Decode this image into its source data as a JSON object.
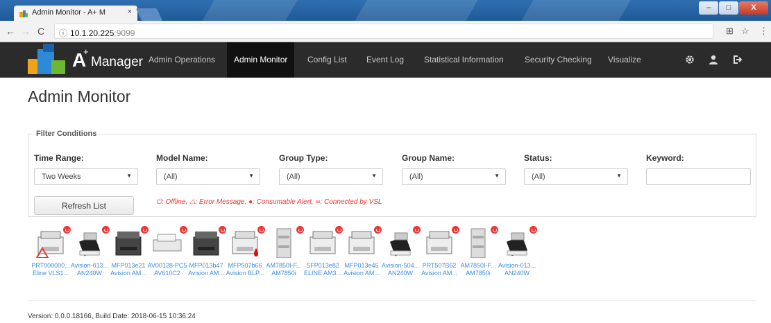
{
  "browser": {
    "tab_title": "Admin Monitor - A+ M",
    "tab_close": "×",
    "url_host": "10.1.20.225",
    "url_port": ":9099",
    "window_buttons": [
      "–",
      "□",
      "X"
    ]
  },
  "app": {
    "logo_letter": "A",
    "logo_plus": "+",
    "logo_text": "Manager",
    "nav": [
      {
        "label": "Admin Operations"
      },
      {
        "label": "Admin Monitor",
        "active": true
      },
      {
        "label": "Config List"
      },
      {
        "label": "Event Log"
      },
      {
        "label": "Statistical Information"
      },
      {
        "label": "Security Checking"
      },
      {
        "label": "Visualize"
      }
    ],
    "nav_icons": [
      "gear-icon",
      "user-icon",
      "logout-icon"
    ]
  },
  "page": {
    "title": "Admin Monitor",
    "filter_legend": "Filter Conditions",
    "filters": {
      "time_range": {
        "label": "Time Range:",
        "value": "Two Weeks"
      },
      "model_name": {
        "label": "Model Name:",
        "value": "(All)"
      },
      "group_type": {
        "label": "Group Type:",
        "value": "(All)"
      },
      "group_name": {
        "label": "Group Name:",
        "value": "(All)"
      },
      "status": {
        "label": "Status:",
        "value": "(All)"
      },
      "keyword": {
        "label": "Keyword:",
        "value": ""
      }
    },
    "refresh_label": "Refresh List",
    "legend": {
      "offline": ": Offline,",
      "error": ": Error Message,",
      "consumable": ": Consumable Alert,",
      "vsl": ": Connected by VSL"
    },
    "devices": [
      {
        "line1": "PRT000000...",
        "line2": "Eline VLS1...",
        "kind": "mfp",
        "error": true
      },
      {
        "line1": "Avision-013...",
        "line2": "AN240W",
        "kind": "scanner"
      },
      {
        "line1": "MFP013e21",
        "line2": "Avision AM...",
        "kind": "mfp-dark"
      },
      {
        "line1": "AV00128-PC5",
        "line2": "AV610C2",
        "kind": "flatbed"
      },
      {
        "line1": "MFP013b47",
        "line2": "Avision AM...",
        "kind": "mfp-dark"
      },
      {
        "line1": "MFP507b66",
        "line2": "Avision BLP...",
        "kind": "mfp",
        "consumable": true
      },
      {
        "line1": "AM7850I-F...",
        "line2": "AM7850i",
        "kind": "tower"
      },
      {
        "line1": "SFP013e82",
        "line2": "ELINE AM3...",
        "kind": "mfp"
      },
      {
        "line1": "MFP013e45",
        "line2": "Avision AM...",
        "kind": "mfp"
      },
      {
        "line1": "Avision-504...",
        "line2": "AN240W",
        "kind": "scanner"
      },
      {
        "line1": "PRT507B62",
        "line2": "Avision AM...",
        "kind": "mfp"
      },
      {
        "line1": "AM7850I-F...",
        "line2": "AM7850i",
        "kind": "tower"
      },
      {
        "line1": "Avision-013...",
        "line2": "AN240W",
        "kind": "scanner"
      }
    ],
    "version": "Version: 0.0.0.18166, Build Date: 2018-06-15 10:36:24"
  },
  "colors": {
    "nav_bg": "#2b2b2b",
    "accent_red": "#e33333",
    "link_blue": "#3a8de0"
  }
}
